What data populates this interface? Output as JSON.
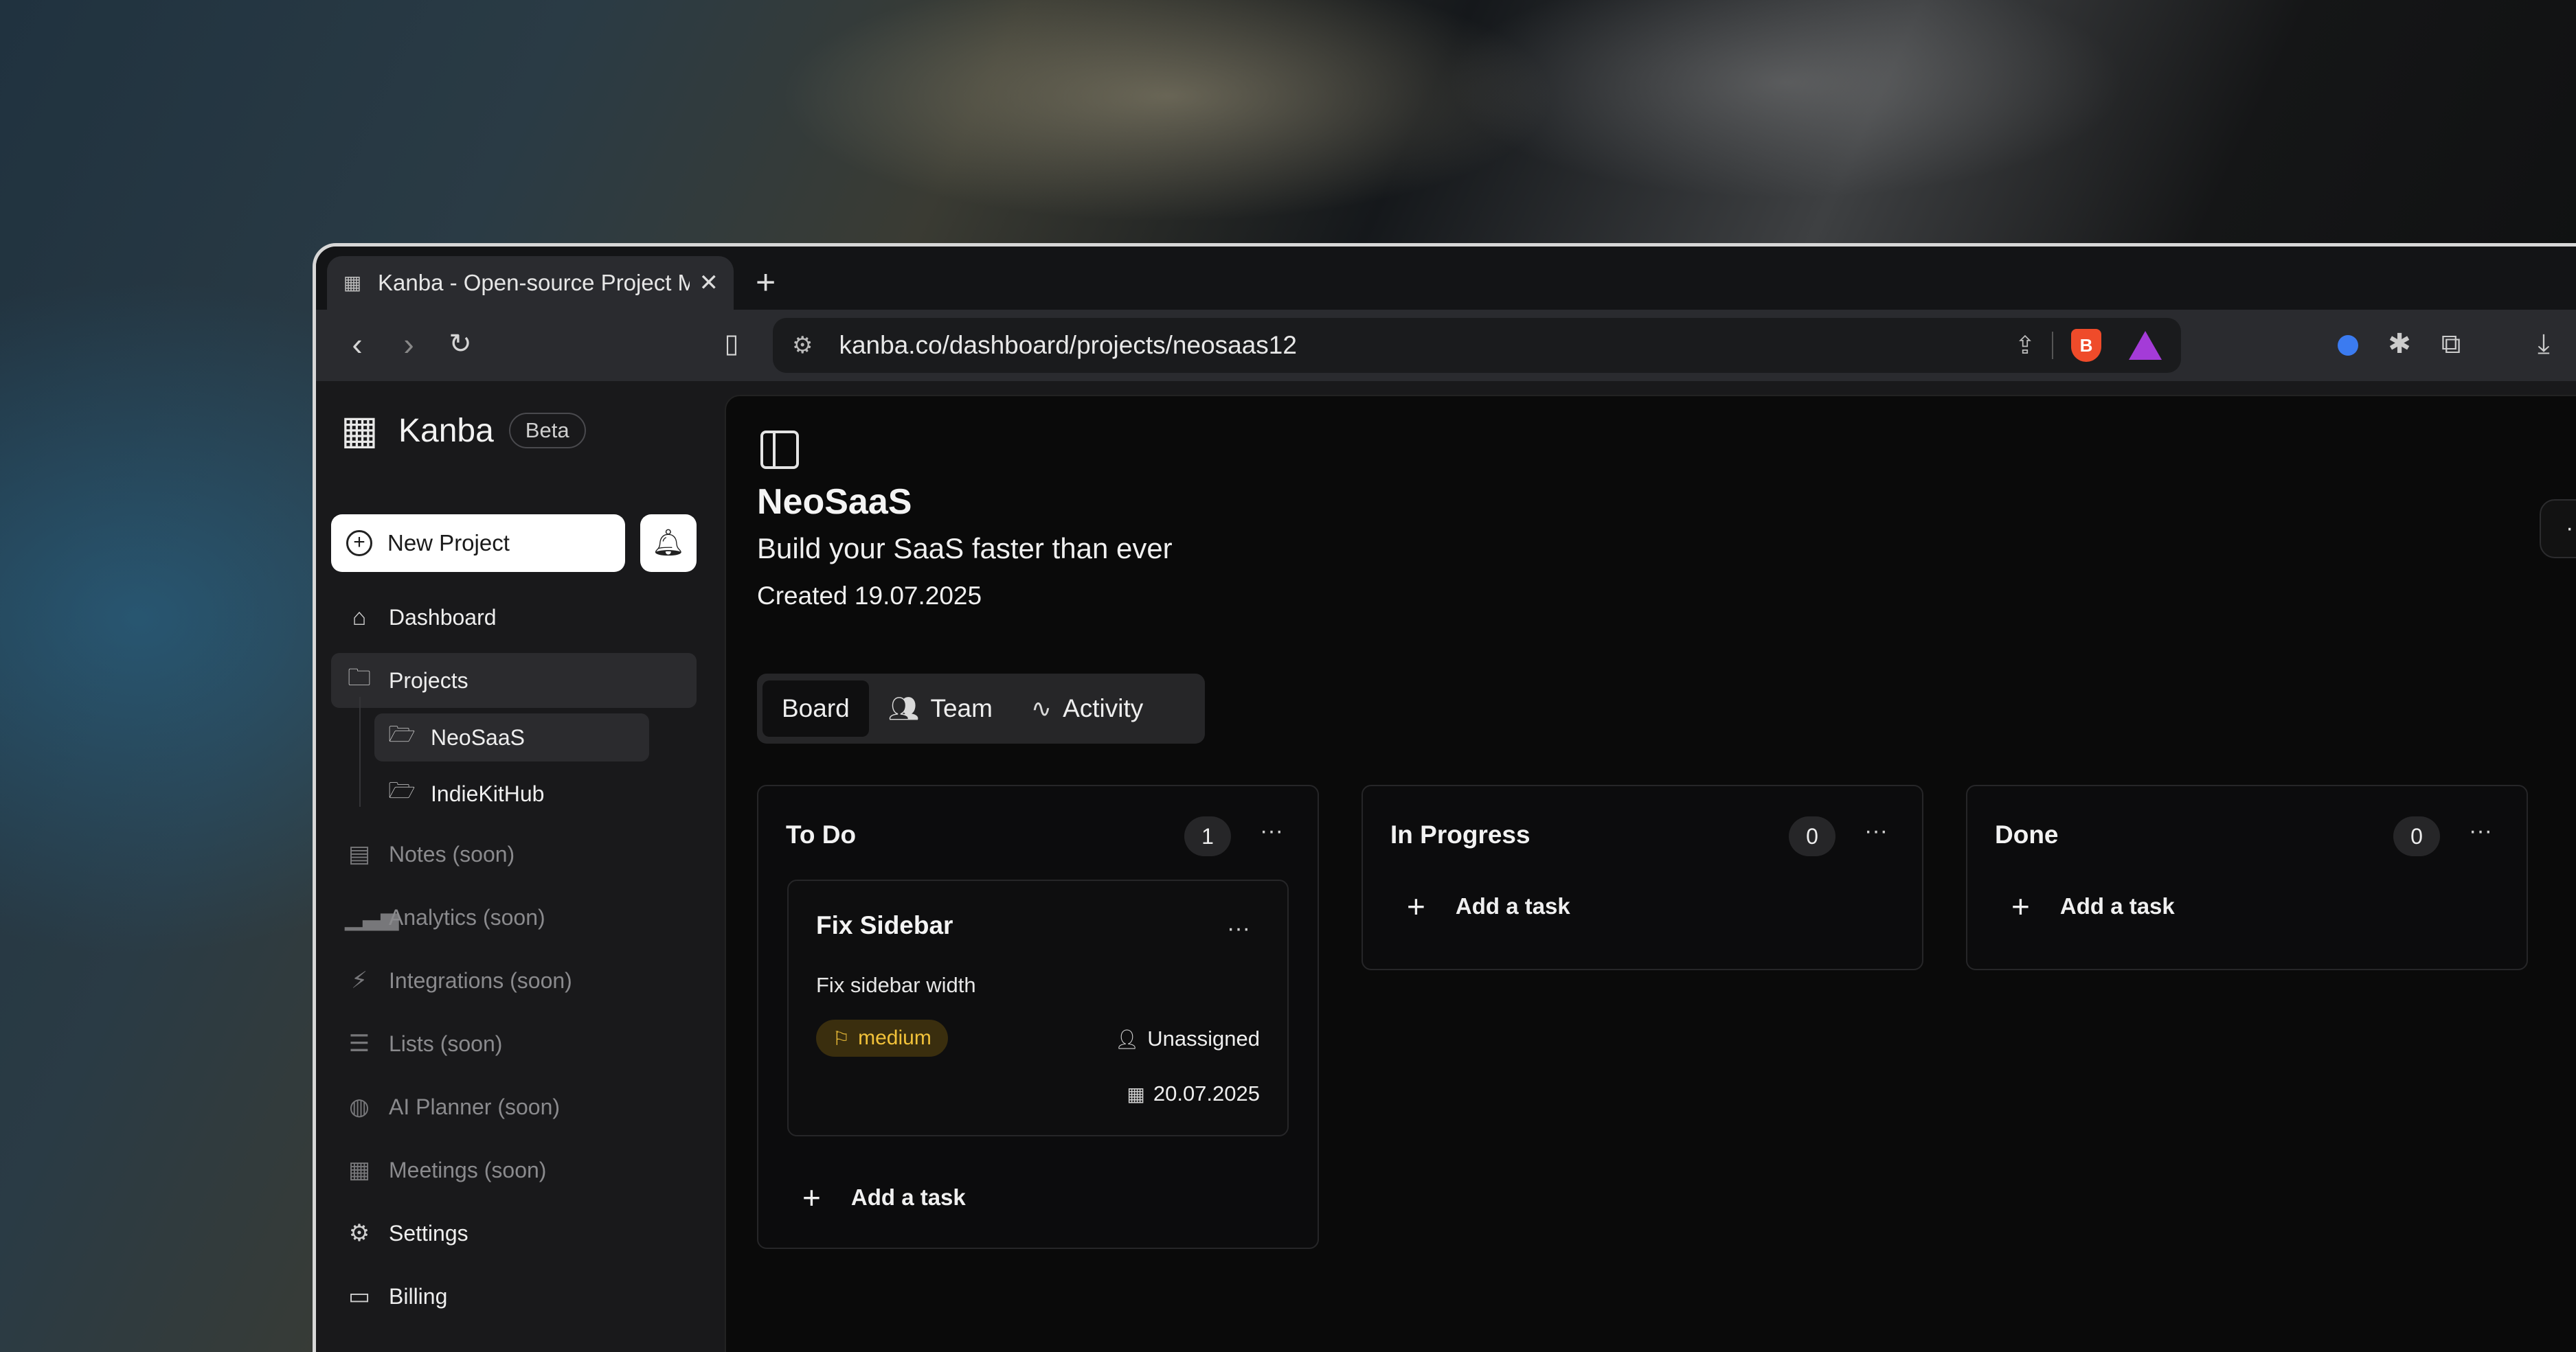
{
  "browser": {
    "tab_title": "Kanba - Open-source Project Management",
    "tab_close": "✕",
    "new_tab": "+",
    "url": "kanba.co/dashboard/projects/neosaas12"
  },
  "sidebar": {
    "brand_name": "Kanba",
    "beta_badge": "Beta",
    "new_project_label": "New Project",
    "items": [
      {
        "label": "Dashboard",
        "icon": "home-icon"
      },
      {
        "label": "Projects",
        "icon": "folder-icon"
      },
      {
        "label": "Notes (soon)",
        "icon": "notes-icon"
      },
      {
        "label": "Analytics (soon)",
        "icon": "bar-chart-icon"
      },
      {
        "label": "Integrations (soon)",
        "icon": "plug-icon"
      },
      {
        "label": "Lists (soon)",
        "icon": "list-icon"
      },
      {
        "label": "AI Planner (soon)",
        "icon": "brain-icon"
      },
      {
        "label": "Meetings (soon)",
        "icon": "calendar-icon"
      },
      {
        "label": "Settings",
        "icon": "gear-icon"
      },
      {
        "label": "Billing",
        "icon": "credit-card-icon"
      }
    ],
    "projects": [
      {
        "label": "NeoSaaS"
      },
      {
        "label": "IndieKitHub"
      }
    ]
  },
  "project": {
    "title": "NeoSaaS",
    "description": "Build your SaaS faster than ever",
    "created": "Created 19.07.2025",
    "more": "···"
  },
  "tabs": [
    {
      "label": "Board"
    },
    {
      "label": "Team"
    },
    {
      "label": "Activity"
    }
  ],
  "columns": [
    {
      "title": "To Do",
      "count": "1",
      "add_label": "Add a task"
    },
    {
      "title": "In Progress",
      "count": "0",
      "add_label": "Add a task"
    },
    {
      "title": "Done",
      "count": "0",
      "add_label": "Add a task"
    }
  ],
  "card": {
    "title": "Fix Sidebar",
    "description": "Fix sidebar width",
    "priority": "medium",
    "assignee": "Unassigned",
    "due": "20.07.2025"
  },
  "colors": {
    "priority_medium_text": "#f2c23a",
    "priority_medium_bg": "#3a2e0e",
    "brave_accent": "#ef4b2a"
  }
}
